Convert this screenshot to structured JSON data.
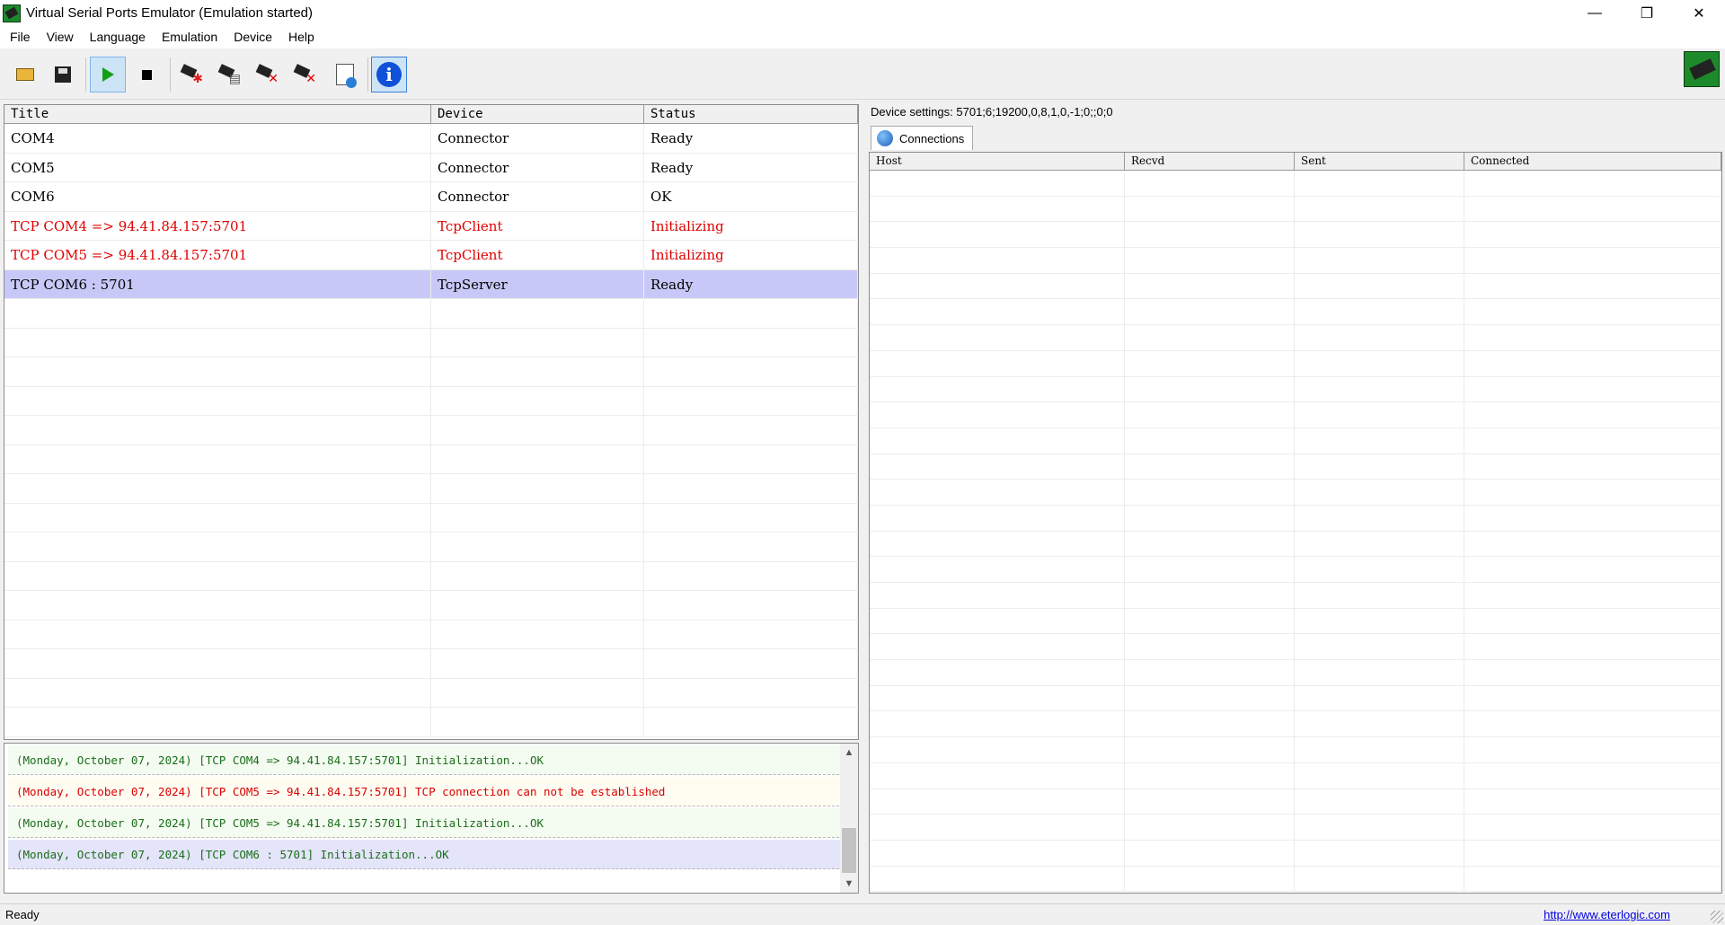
{
  "window": {
    "title": "Virtual Serial Ports Emulator (Emulation started)",
    "controls": {
      "minimize": "—",
      "restore": "❐",
      "close": "✕"
    }
  },
  "menu": [
    "File",
    "View",
    "Language",
    "Emulation",
    "Device",
    "Help"
  ],
  "toolbar": {
    "buttons": [
      {
        "name": "open-icon"
      },
      {
        "name": "save-icon"
      },
      {
        "name": "play-icon",
        "state": "pressed"
      },
      {
        "name": "stop-icon"
      },
      {
        "name": "new-device-icon"
      },
      {
        "name": "edit-device-icon"
      },
      {
        "name": "delete-device-icon"
      },
      {
        "name": "delete-all-icon"
      },
      {
        "name": "settings-page-icon"
      },
      {
        "name": "info-icon",
        "state": "active"
      }
    ],
    "info_glyph": "i"
  },
  "device_grid": {
    "columns": [
      "Title",
      "Device",
      "Status"
    ],
    "rows": [
      {
        "title": "COM4",
        "device": "Connector",
        "status": "Ready",
        "state": "normal"
      },
      {
        "title": "COM5",
        "device": "Connector",
        "status": "Ready",
        "state": "normal"
      },
      {
        "title": "COM6",
        "device": "Connector",
        "status": "OK",
        "state": "normal"
      },
      {
        "title": "TCP COM4 => 94.41.84.157:5701",
        "device": "TcpClient",
        "status": "Initializing",
        "state": "error"
      },
      {
        "title": "TCP COM5 => 94.41.84.157:5701",
        "device": "TcpClient",
        "status": "Initializing",
        "state": "error"
      },
      {
        "title": "TCP COM6 : 5701",
        "device": "TcpServer",
        "status": "Ready",
        "state": "selected"
      }
    ],
    "empty_rows": 15
  },
  "log": {
    "lines": [
      {
        "text": "(Monday, October 07, 2024) [TCP COM4 => 94.41.84.157:5701] Initialization...OK",
        "type": "ok"
      },
      {
        "text": "(Monday, October 07, 2024) [TCP COM5 => 94.41.84.157:5701] TCP connection can not be established",
        "type": "err"
      },
      {
        "text": "(Monday, October 07, 2024) [TCP COM5 => 94.41.84.157:5701] Initialization...OK",
        "type": "ok"
      },
      {
        "text": "(Monday, October 07, 2024) [TCP COM6 : 5701] Initialization...OK",
        "type": "sel"
      }
    ],
    "scroll_up": "▲",
    "scroll_down": "▼"
  },
  "right_panel": {
    "device_settings": "Device settings: 5701;6;19200,0,8,1,0,-1;0;;0;0",
    "tab_label": "Connections",
    "columns": [
      "Host",
      "Recvd",
      "Sent",
      "Connected"
    ],
    "empty_rows": 28
  },
  "statusbar": {
    "text": "Ready",
    "link": "http://www.eterlogic.com"
  }
}
